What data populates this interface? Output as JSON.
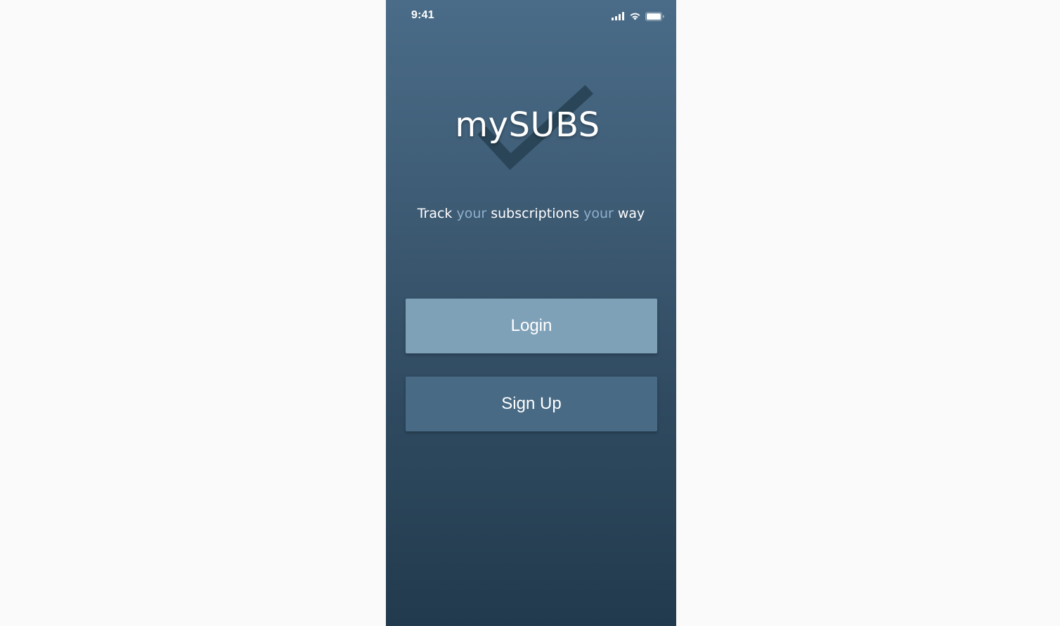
{
  "status_bar": {
    "time": "9:41",
    "icons": [
      "signal-icon",
      "wifi-icon",
      "battery-icon"
    ]
  },
  "logo": {
    "text": "mySUBS",
    "icon": "checkmark-icon"
  },
  "tagline": {
    "parts": [
      "Track ",
      "your",
      " subscriptions ",
      "your",
      " way"
    ]
  },
  "buttons": {
    "login_label": "Login",
    "signup_label": "Sign Up"
  },
  "colors": {
    "background_top": "#4a6c88",
    "background_bottom": "#223a4d",
    "login_button": "#7fa1b8",
    "signup_button": "#486a84",
    "tagline_accent": "#8fb0cb",
    "checkmark": "#2a4557"
  }
}
